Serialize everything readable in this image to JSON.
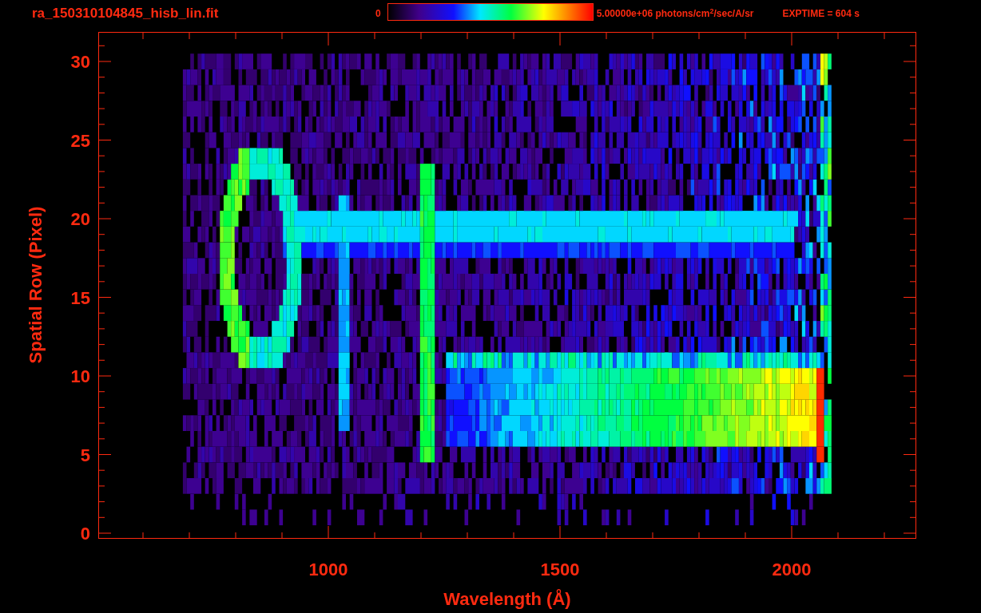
{
  "title": "ra_150310104845_hisb_lin.fit",
  "colorbar": {
    "min_label": "0",
    "max_label": "5.00000e+06 photons/cm$^{2}$/sec/A/sr"
  },
  "exposure": "EXPTIME = 604 s",
  "plot": {
    "xlabel": "Wavelength (Å)",
    "ylabel": "Spatial Row (Pixel)",
    "xticks": [
      "1000",
      "1500",
      "2000"
    ],
    "yticks": [
      "30",
      "25",
      "20",
      "15",
      "10",
      "5",
      "0"
    ]
  }
}
